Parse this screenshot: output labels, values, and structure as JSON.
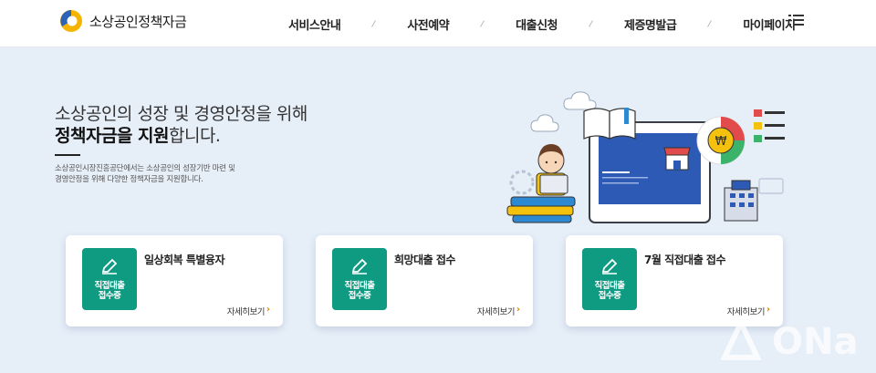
{
  "header": {
    "logo_text": "소상공인정책자금",
    "nav": [
      "서비스안내",
      "사전예약",
      "대출신청",
      "제증명발급",
      "마이페이지"
    ]
  },
  "hero": {
    "title_line1": "소상공인의 성장 및 경영안정을 위해",
    "title_bold": "정책자금을 지원",
    "title_rest": "합니다.",
    "desc_line1": "소상공인시장진흥공단에서는 소상공인의 성장기반 마련 및",
    "desc_line2": "경영안정을 위해 다양한 정책자금을 지원합니다."
  },
  "cards": [
    {
      "title": "일상회복 특별융자",
      "badge": "직접대출\n접수중",
      "more": "자세히보기"
    },
    {
      "title": "희망대출 접수",
      "badge": "직접대출\n접수중",
      "more": "자세히보기"
    },
    {
      "title": "7월 직접대출 접수",
      "badge": "직접대출\n접수중",
      "more": "자세히보기"
    }
  ],
  "watermark": "ONa",
  "colors": {
    "accent": "#0f9a82",
    "more_arrow": "#e07b00",
    "background": "#e6eef8"
  }
}
